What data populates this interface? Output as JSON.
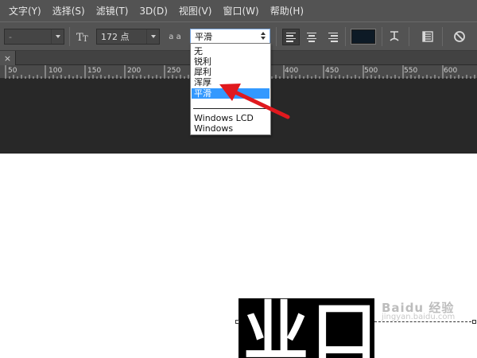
{
  "menu": [
    "文字(Y)",
    "选择(S)",
    "滤镜(T)",
    "3D(D)",
    "视图(V)",
    "窗口(W)",
    "帮助(H)"
  ],
  "options": {
    "font_family_value": "-",
    "font_size_value": "172 点",
    "aa_label": "a a",
    "antialias_value": "平滑",
    "text_color": "#0d1a26"
  },
  "tab": {
    "close": "×"
  },
  "ruler": {
    "labels": [
      "50",
      "100",
      "150",
      "200",
      "250",
      "400",
      "450",
      "500",
      "550",
      "600"
    ]
  },
  "antialias_menu": {
    "items": [
      "无",
      "锐利",
      "犀利",
      "浑厚",
      "平滑"
    ],
    "selected": "平滑",
    "extra_items": [
      "Windows LCD",
      "Windows"
    ]
  },
  "canvas": {
    "glyphs": [
      "业",
      "口"
    ]
  },
  "watermark": {
    "line1": "Baidu 经验",
    "line2": "jingyan.baidu.com"
  },
  "colors": {
    "ui_dark": "#535353",
    "pasteboard": "#282828",
    "highlight": "#3399ff",
    "arrow": "#e0191e"
  },
  "icons": [
    "dropdown-caret-icon",
    "text-orientation-icon",
    "antialias-icon",
    "align-left-icon",
    "align-center-icon",
    "align-right-icon",
    "warp-text-icon",
    "character-panel-icon",
    "cancel-icon",
    "red-arrow-icon"
  ]
}
